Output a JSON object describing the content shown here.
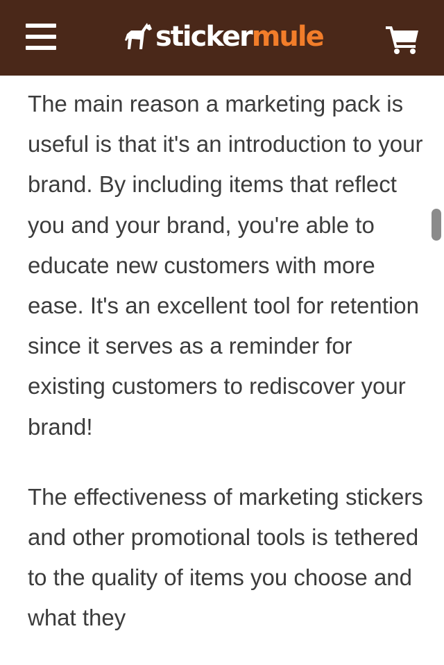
{
  "header": {
    "brand": {
      "part1": "sticker",
      "part2": "mule"
    },
    "menu_icon": "hamburger-menu-icon",
    "cart_icon": "shopping-cart-icon",
    "logo_icon": "mule-icon",
    "colors": {
      "background": "#4a2819",
      "brand_accent": "#f27d2a",
      "text": "#ffffff"
    }
  },
  "article": {
    "paragraphs": [
      "The main reason a marketing pack is useful is that it's an introduction to your brand. By including items that reflect you and your brand, you're able to educate new customers with more ease. It's an excellent tool for retention since it serves as a reminder for existing customers to rediscover your brand!",
      "The effectiveness of marketing stickers and other promotional tools is tethered to the quality of items you choose and what they"
    ]
  }
}
